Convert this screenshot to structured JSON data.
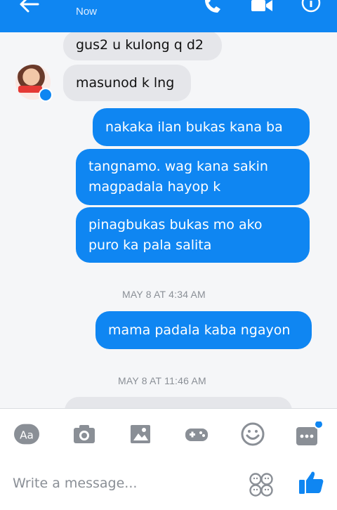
{
  "header": {
    "status": "Now",
    "accent": "#0f86f2"
  },
  "messages": {
    "m1": "gus2 u kulong q d2",
    "m2": "masunod k lng",
    "m3": "nakaka ilan bukas kana ba",
    "m4_line1": "tangnamo. wag kana sakin",
    "m4_line2": "magpadala hayop k",
    "m5_line1": "pinagbukas bukas mo ako",
    "m5_line2": "puro ka pala salita",
    "ts1": "MAY 8 AT 4:34 AM",
    "m6": "mama padala kaba ngayon",
    "ts2": "MAY 8 AT 11:46 AM"
  },
  "toolbar": {
    "aa_label": "Aa",
    "placeholder": "Write a message...",
    "icons": [
      "aa-icon",
      "camera-icon",
      "gallery-icon",
      "game-icon",
      "smiley-icon",
      "more-icon",
      "emoji-icon",
      "thumbs-up-icon"
    ]
  }
}
